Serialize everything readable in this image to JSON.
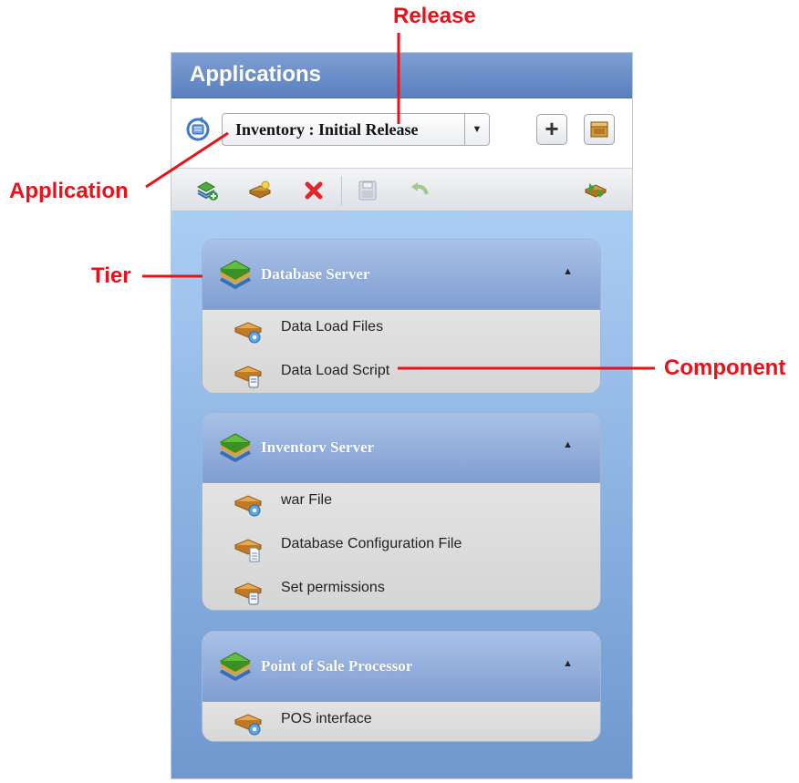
{
  "annotations": {
    "release": "Release",
    "application": "Application",
    "tier": "Tier",
    "component": "Component"
  },
  "panel": {
    "title": "Applications",
    "selected_application": "Inventory : Initial Release",
    "add_button_glyph": "+"
  },
  "toolbar": {
    "icons": [
      "add-tier-icon",
      "add-component-icon",
      "delete-icon",
      "save-icon",
      "undo-icon",
      "deploy-icon"
    ]
  },
  "tiers": [
    {
      "name": "Database Server",
      "components": [
        {
          "name": "Data Load Files",
          "icon": "component-gear-icon"
        },
        {
          "name": "Data Load Script",
          "icon": "component-script-icon"
        }
      ]
    },
    {
      "name": "Inventorv Server",
      "components": [
        {
          "name": "war File",
          "icon": "component-gear-icon"
        },
        {
          "name": "Database Configuration File",
          "icon": "component-file-icon"
        },
        {
          "name": "Set permissions",
          "icon": "component-script-icon"
        }
      ]
    },
    {
      "name": "Point of Sale Processor",
      "components": [
        {
          "name": "POS interface",
          "icon": "component-gear-icon"
        }
      ]
    }
  ],
  "colors": {
    "annotation": "#e8121a",
    "title_bar": "#5a80c1",
    "content_bg_top": "#aacdf4",
    "content_bg_bottom": "#6f98cf"
  }
}
